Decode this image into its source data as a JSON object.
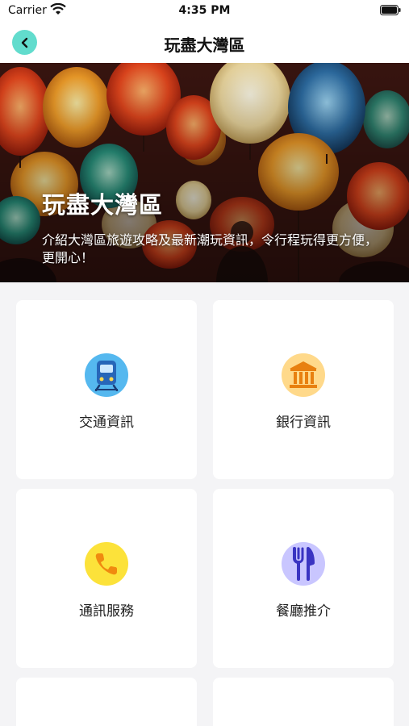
{
  "status_bar": {
    "carrier": "Carrier",
    "time": "4:35 PM"
  },
  "nav": {
    "title": "玩盡大灣區",
    "back_icon": "chevron-left-icon",
    "accent": "#62dccd"
  },
  "hero": {
    "title": "玩盡大灣區",
    "description": "介紹大灣區旅遊攻略及最新潮玩資訊，令行程玩得更方便，更開心！"
  },
  "categories": [
    {
      "label": "交通資訊",
      "icon": "train-icon",
      "icon_bg": "#55b8ef"
    },
    {
      "label": "銀行資訊",
      "icon": "bank-icon",
      "icon_bg": "#ffd98a"
    },
    {
      "label": "通訊服務",
      "icon": "phone-icon",
      "icon_bg": "#fce23a"
    },
    {
      "label": "餐廳推介",
      "icon": "fork-knife-icon",
      "icon_bg": "#c9c6ff"
    }
  ]
}
